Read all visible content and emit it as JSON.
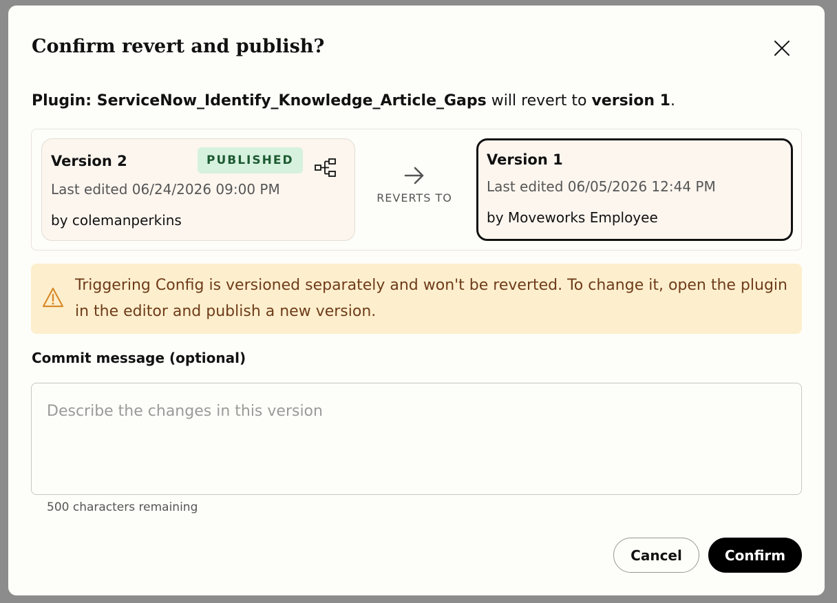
{
  "dialog": {
    "title": "Confirm revert and publish?",
    "subtitle": {
      "prefix": "Plugin: ServiceNow_Identify_Knowledge_Article_Gaps",
      "middle": " will revert to ",
      "version_ref": "version 1",
      "suffix": "."
    }
  },
  "from_version": {
    "name": "Version 2",
    "badge": "PUBLISHED",
    "last_edited": "Last edited 06/24/2026 09:00 PM",
    "by": "by colemanperkins",
    "icon": "tree-structure-icon"
  },
  "reverts_label": "REVERTS TO",
  "to_version": {
    "name": "Version 1",
    "last_edited": "Last edited 06/05/2026 12:44 PM",
    "by": "by Moveworks Employee"
  },
  "warning": {
    "icon": "warning-icon",
    "text": "Triggering Config is versioned separately and won't be reverted. To change it, open the plugin in the editor and publish a new version."
  },
  "commit": {
    "label": "Commit message (optional)",
    "placeholder": "Describe the changes in this version",
    "value": "",
    "remaining": "500 characters remaining"
  },
  "buttons": {
    "cancel": "Cancel",
    "confirm": "Confirm"
  },
  "colors": {
    "badge_bg": "#d7f1df",
    "badge_text": "#1d5a31",
    "warning_bg": "#fdefcd",
    "warning_text": "#6e3b1a",
    "warning_icon": "#d88a2c",
    "primary": "#000000"
  }
}
